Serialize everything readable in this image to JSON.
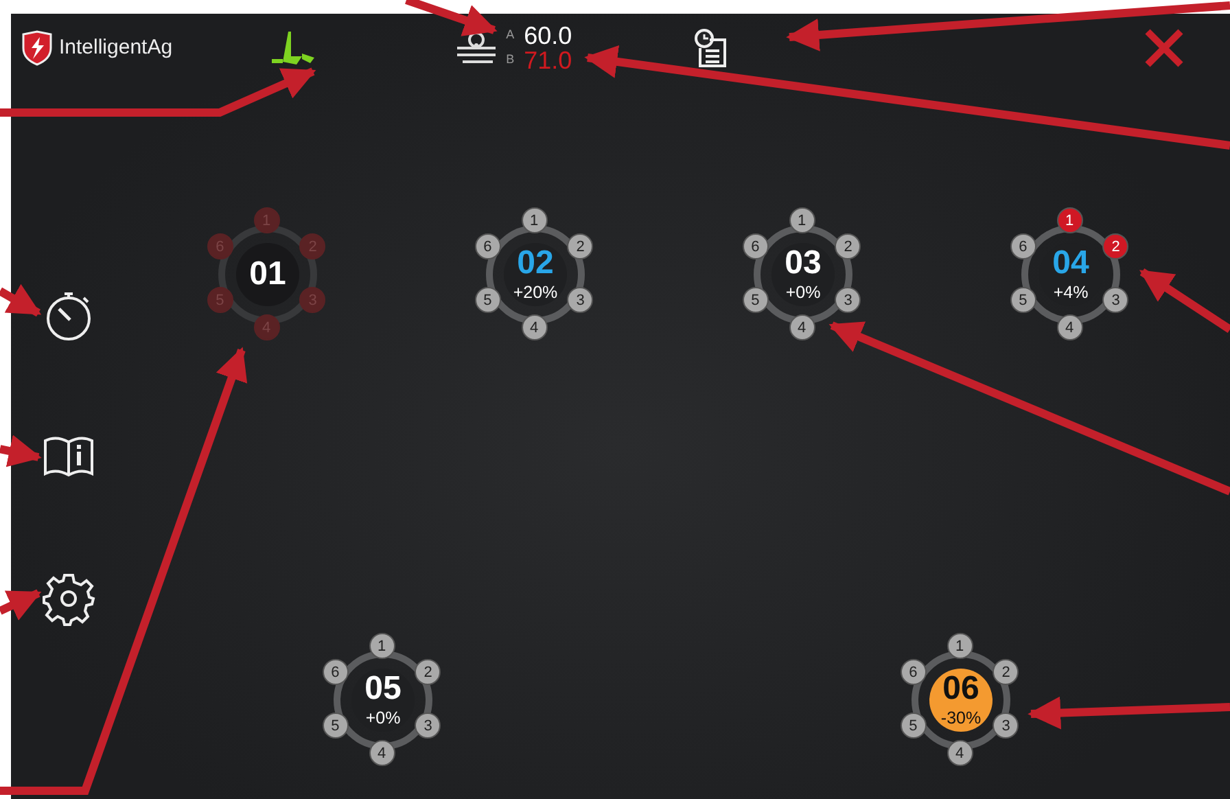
{
  "header": {
    "logo_text": "IntelligentAg",
    "rates": [
      {
        "letter": "A",
        "value": "60.0",
        "alarm": false
      },
      {
        "letter": "B",
        "value": "71.0",
        "alarm": true
      }
    ]
  },
  "sections": [
    {
      "label": "01",
      "disabled": true,
      "override": false,
      "rows": [
        {
          "label": "1",
          "alarm": false
        },
        {
          "label": "2",
          "alarm": false
        },
        {
          "label": "3",
          "alarm": false
        },
        {
          "label": "4",
          "alarm": false
        },
        {
          "label": "5",
          "alarm": false
        },
        {
          "label": "6",
          "alarm": false
        }
      ]
    },
    {
      "label": "02",
      "disabled": false,
      "override": false,
      "color": "#29a6e8",
      "rate": "+20%",
      "rows": [
        {
          "label": "1",
          "alarm": false
        },
        {
          "label": "2",
          "alarm": false
        },
        {
          "label": "3",
          "alarm": false
        },
        {
          "label": "4",
          "alarm": false
        },
        {
          "label": "5",
          "alarm": false
        },
        {
          "label": "6",
          "alarm": false
        }
      ]
    },
    {
      "label": "03",
      "disabled": false,
      "override": false,
      "color": "#ffffff",
      "rate": "+0%",
      "rows": [
        {
          "label": "1",
          "alarm": false
        },
        {
          "label": "2",
          "alarm": false
        },
        {
          "label": "3",
          "alarm": false
        },
        {
          "label": "4",
          "alarm": false
        },
        {
          "label": "5",
          "alarm": false
        },
        {
          "label": "6",
          "alarm": false
        }
      ]
    },
    {
      "label": "04",
      "disabled": false,
      "override": false,
      "color": "#29a6e8",
      "rate": "+4%",
      "rows": [
        {
          "label": "1",
          "alarm": true
        },
        {
          "label": "2",
          "alarm": true
        },
        {
          "label": "3",
          "alarm": false
        },
        {
          "label": "4",
          "alarm": false
        },
        {
          "label": "5",
          "alarm": false
        },
        {
          "label": "6",
          "alarm": false
        }
      ]
    },
    {
      "label": "05",
      "disabled": false,
      "override": false,
      "color": "#ffffff",
      "rate": "+0%",
      "rows": [
        {
          "label": "1",
          "alarm": false
        },
        {
          "label": "2",
          "alarm": false
        },
        {
          "label": "3",
          "alarm": false
        },
        {
          "label": "4",
          "alarm": false
        },
        {
          "label": "5",
          "alarm": false
        },
        {
          "label": "6",
          "alarm": false
        }
      ]
    },
    {
      "label": "06",
      "disabled": false,
      "override": true,
      "color": "#111111",
      "rate": "-30%",
      "rows": [
        {
          "label": "1",
          "alarm": false
        },
        {
          "label": "2",
          "alarm": false
        },
        {
          "label": "3",
          "alarm": false
        },
        {
          "label": "4",
          "alarm": false
        },
        {
          "label": "5",
          "alarm": false
        },
        {
          "label": "6",
          "alarm": false
        }
      ]
    }
  ]
}
